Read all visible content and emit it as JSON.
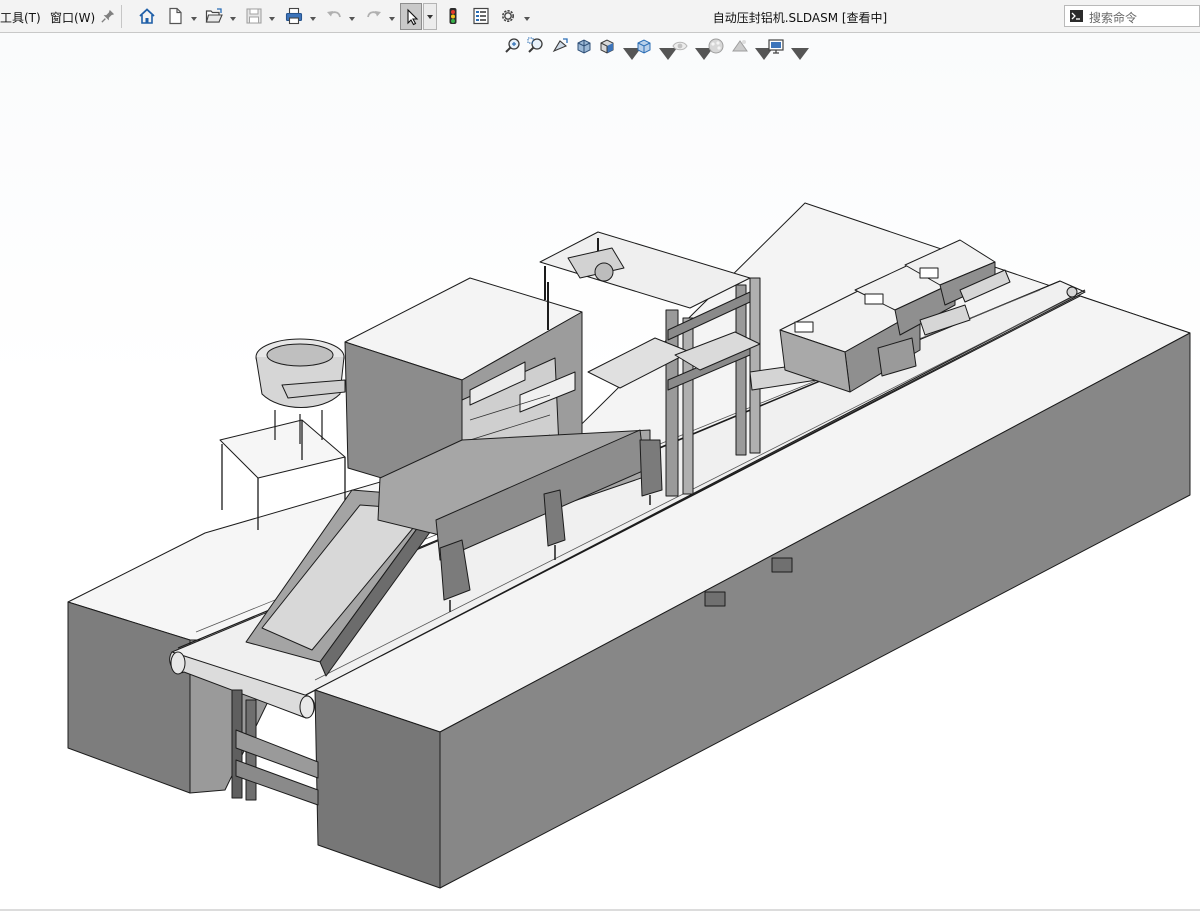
{
  "menu": {
    "tools": "工具(T)",
    "window": "窗口(W)"
  },
  "toolbar": {
    "icons": [
      "home-icon",
      "new-document-icon",
      "open-folder-icon",
      "save-icon",
      "print-icon",
      "undo-icon",
      "redo-icon",
      "select-arrow-icon",
      "rebuild-traffic-light-icon",
      "file-properties-icon",
      "options-gear-icon"
    ]
  },
  "window_title": "自动压封铝机.SLDASM [查看中]",
  "search": {
    "placeholder": "搜索命令"
  },
  "heads_up_toolbar": {
    "icons": [
      "zoom-to-fit-icon",
      "zoom-to-area-icon",
      "previous-view-icon",
      "section-view-icon",
      "view-orientation-icon",
      "display-style-icon",
      "hide-show-items-icon",
      "edit-appearance-icon",
      "apply-scene-icon",
      "view-settings-icon"
    ]
  },
  "colors": {
    "toolbar_bg": "#f3f3f3",
    "accent_blue": "#2a6db5",
    "model_body": "#8a8a8a",
    "model_top": "#f4f4f4",
    "model_edge": "#1c1c1c"
  }
}
